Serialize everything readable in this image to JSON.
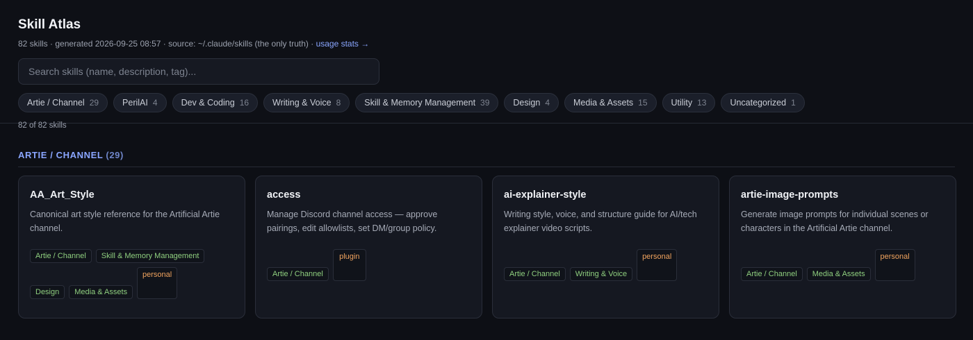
{
  "header": {
    "title": "Skill Atlas",
    "subtitle": "82 skills · generated 2026-09-25 08:57 · source: ~/.claude/skills (the only truth) · ",
    "stats_link": "usage stats →"
  },
  "search": {
    "placeholder": "Search skills (name, description, tag)...",
    "value": ""
  },
  "categories": [
    {
      "label": "Artie / Channel",
      "count": "29"
    },
    {
      "label": "PerilAI",
      "count": "4"
    },
    {
      "label": "Dev & Coding",
      "count": "16"
    },
    {
      "label": "Writing & Voice",
      "count": "8"
    },
    {
      "label": "Skill & Memory Management",
      "count": "39"
    },
    {
      "label": "Design",
      "count": "4"
    },
    {
      "label": "Media & Assets",
      "count": "15"
    },
    {
      "label": "Utility",
      "count": "13"
    },
    {
      "label": "Uncategorized",
      "count": "1"
    }
  ],
  "result_count": "82 of 82 skills",
  "section": {
    "title": "ARTIE / CHANNEL",
    "count": "(29)"
  },
  "cards": [
    {
      "title": "AA_Art_Style",
      "description": "Canonical art style reference for the Artificial Artie channel.",
      "tags": [
        "Artie / Channel",
        "Skill & Memory Management",
        "Design",
        "Media & Assets"
      ],
      "source": "personal"
    },
    {
      "title": "access",
      "description": "Manage Discord channel access — approve pairings, edit allowlists, set DM/group policy.",
      "tags": [
        "Artie / Channel"
      ],
      "source": "plugin"
    },
    {
      "title": "ai-explainer-style",
      "description": "Writing style, voice, and structure guide for AI/tech explainer video scripts.",
      "tags": [
        "Artie / Channel",
        "Writing & Voice"
      ],
      "source": "personal"
    },
    {
      "title": "artie-image-prompts",
      "description": "Generate image prompts for individual scenes or characters in the Artificial Artie channel.",
      "tags": [
        "Artie / Channel",
        "Media & Assets"
      ],
      "source": "personal"
    }
  ],
  "colors": {
    "background": "#0d0f15",
    "accent": "#8aa6ff",
    "tag_text": "#8fcf7f",
    "source_text": "#f0a35e"
  }
}
